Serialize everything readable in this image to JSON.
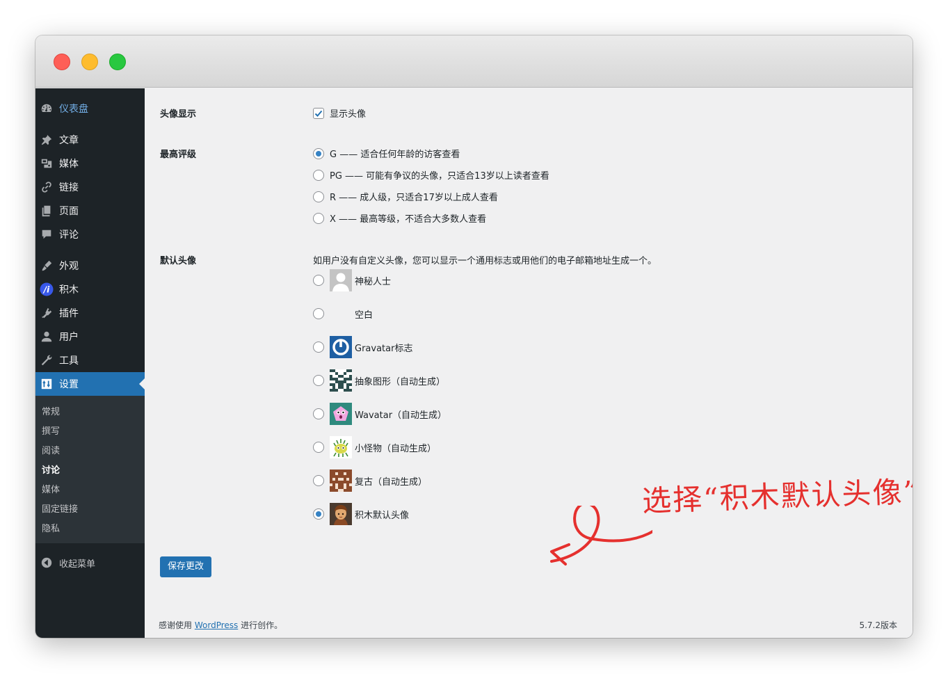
{
  "window": {
    "buttons": [
      "close",
      "minimize",
      "zoom"
    ]
  },
  "sidebar": {
    "dashboard": {
      "label": "仪表盘",
      "icon": "dashboard-icon"
    },
    "items": [
      {
        "label": "文章",
        "icon": "pin-icon"
      },
      {
        "label": "媒体",
        "icon": "media-icon"
      },
      {
        "label": "链接",
        "icon": "link-icon"
      },
      {
        "label": "页面",
        "icon": "page-icon"
      },
      {
        "label": "评论",
        "icon": "comment-icon"
      },
      {
        "label": "外观",
        "icon": "brush-icon"
      },
      {
        "label": "积木",
        "icon": "jimu-logo-icon"
      },
      {
        "label": "插件",
        "icon": "plugin-icon"
      },
      {
        "label": "用户",
        "icon": "user-icon"
      },
      {
        "label": "工具",
        "icon": "wrench-icon"
      },
      {
        "label": "设置",
        "icon": "settings-icon"
      }
    ],
    "submenu": [
      "常规",
      "撰写",
      "阅读",
      "讨论",
      "媒体",
      "固定链接",
      "隐私"
    ],
    "submenu_current": "讨论",
    "collapse": "收起菜单"
  },
  "settings": {
    "avatar_display": {
      "label": "头像显示",
      "checkbox_label": "显示头像",
      "checked": true
    },
    "max_rating": {
      "label": "最高评级",
      "options": [
        "G —— 适合任何年龄的访客查看",
        "PG —— 可能有争议的头像，只适合13岁以上读者查看",
        "R —— 成人级，只适合17岁以上成人查看",
        "X —— 最高等级，不适合大多数人查看"
      ],
      "selected": 0
    },
    "default_avatar": {
      "label": "默认头像",
      "description": "如用户没有自定义头像，您可以显示一个通用标志或用他们的电子邮箱地址生成一个。",
      "options": [
        "神秘人士",
        "空白",
        "Gravatar标志",
        "抽象图形（自动生成）",
        "Wavatar（自动生成）",
        "小怪物（自动生成）",
        "复古（自动生成）",
        "积木默认头像"
      ],
      "selected": 7
    },
    "save_button": "保存更改"
  },
  "footer": {
    "thanks_prefix": "感谢使用",
    "link_text": "WordPress",
    "thanks_suffix": "进行创作。",
    "version": "5.7.2版本"
  },
  "annotation": {
    "text": "选择“积木默认头像”",
    "color": "#e5302e"
  },
  "colors": {
    "accent": "#2271b1",
    "sidebar_bg": "#1d2327",
    "submenu_bg": "#2c3338",
    "content_bg": "#f0f0f1"
  }
}
